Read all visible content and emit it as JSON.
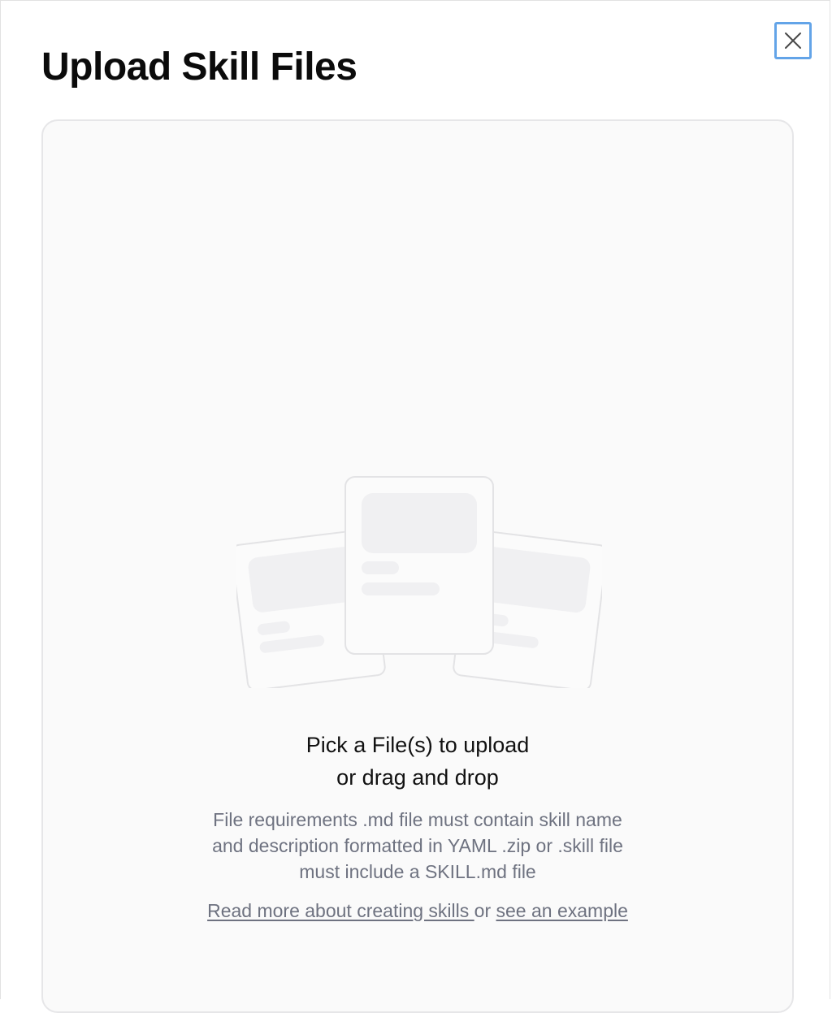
{
  "dialog": {
    "title": "Upload Skill Files",
    "close_icon": "close-icon"
  },
  "dropzone": {
    "illustration_icon": "files-stack-illustration",
    "heading_line1": "Pick a File(s) to upload",
    "heading_line2": "or drag and drop",
    "requirements": "File requirements .md file must contain skill name and description formatted in YAML .zip or .skill file must include a SKILL.md file",
    "read_more_link": "Read more about creating skills ",
    "or_text": "or ",
    "example_link": "see an example"
  },
  "colors": {
    "focus_ring": "#63a4e8",
    "muted_text": "#6e7280",
    "dropzone_bg": "#fafafa"
  }
}
